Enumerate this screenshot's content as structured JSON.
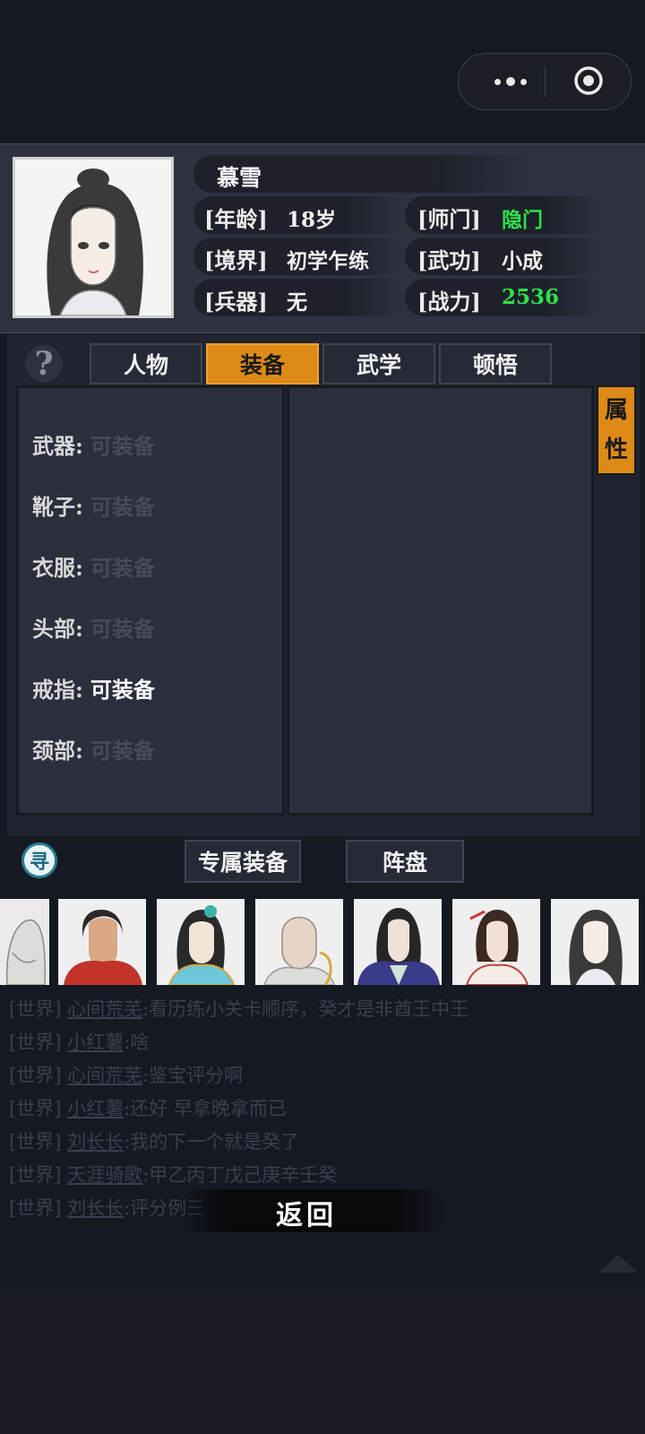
{
  "system_bar": {
    "more_icon": "more-dots-icon",
    "close_icon": "target-circle-icon"
  },
  "profile": {
    "name": "慕雪",
    "fields": [
      {
        "label": "[年龄]",
        "value": "18岁"
      },
      {
        "label": "[师门]",
        "value": "隐门"
      },
      {
        "label": "[境界]",
        "value": "初学乍练"
      },
      {
        "label": "[武功]",
        "value": "小成"
      },
      {
        "label": "[兵器]",
        "value": "无"
      },
      {
        "label": "[战力]",
        "value": "2536"
      }
    ]
  },
  "help_icon": "question-mark-icon",
  "tabs": [
    {
      "label": "人物",
      "active": false
    },
    {
      "label": "装备",
      "active": true
    },
    {
      "label": "武学",
      "active": false
    },
    {
      "label": "顿悟",
      "active": false
    }
  ],
  "equipment_slots": [
    {
      "key": "武器:",
      "value": "可装备"
    },
    {
      "key": "靴子:",
      "value": "可装备"
    },
    {
      "key": "衣服:",
      "value": "可装备"
    },
    {
      "key": "头部:",
      "value": "可装备"
    },
    {
      "key": "戒指:",
      "value": "可装备"
    },
    {
      "key": "颈部:",
      "value": "可装备"
    }
  ],
  "attr_button": {
    "line1": "属",
    "line2": "性"
  },
  "xun_icon": "寻",
  "bottom_buttons": {
    "exclusive": "专属装备",
    "formation": "阵盘"
  },
  "characters": [
    "白衣老者",
    "红巾侠客",
    "青衣女侠",
    "光头僧人",
    "紫裘公子",
    "红衣女子",
    "慕雪"
  ],
  "chat": [
    {
      "channel": "[世界]",
      "name": "心间荒芜",
      "msg": ":看历练小关卡顺序，癸才是非酋王中王"
    },
    {
      "channel": "[世界]",
      "name": "小红薯",
      "msg": ":啥"
    },
    {
      "channel": "[世界]",
      "name": "心间荒芜",
      "msg": ":鉴宝评分啊"
    },
    {
      "channel": "[世界]",
      "name": "小红薯",
      "msg": ":还好 早拿晚拿而已"
    },
    {
      "channel": "[世界]",
      "name": "刘长长",
      "msg": ":我的下一个就是癸了"
    },
    {
      "channel": "[世界]",
      "name": "天涯骑歌",
      "msg": ":甲乙丙丁戊己庚辛壬癸"
    },
    {
      "channel": "[世界]",
      "name": "刘长长",
      "msg": ":评分例三"
    }
  ],
  "back_button": "返回",
  "colors": {
    "accent_orange": "#dd8a18",
    "green_value": "#2fe24a"
  }
}
